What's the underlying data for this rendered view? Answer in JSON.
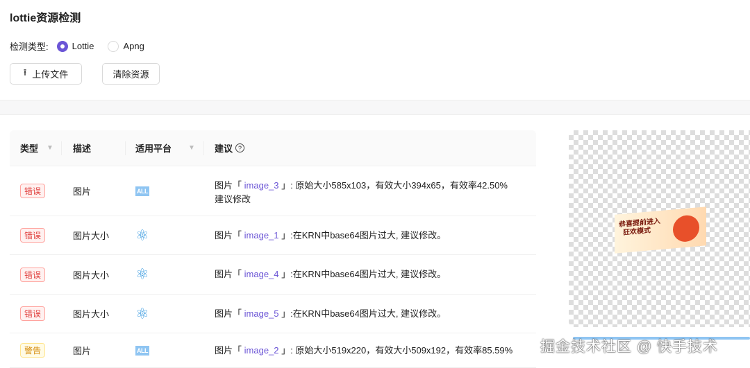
{
  "title": "lottie资源检测",
  "detect": {
    "label": "检测类型:",
    "options": [
      "Lottie",
      "Apng"
    ],
    "selected": "Lottie"
  },
  "buttons": {
    "upload": "上传文件",
    "clear": "清除资源"
  },
  "table": {
    "headers": {
      "type": "类型",
      "desc": "描述",
      "platform": "适用平台",
      "advice": "建议"
    },
    "rows": [
      {
        "tag": "错误",
        "tag_kind": "error",
        "desc": "图片",
        "platform": "ALL",
        "prefix": "图片「",
        "link": "image_3",
        "suffix": "」: 原始大小585x103，有效大小394x65，有效率42.50%",
        "line2": "建议修改"
      },
      {
        "tag": "错误",
        "tag_kind": "error",
        "desc": "图片大小",
        "platform": "react",
        "prefix": "图片「",
        "link": "image_1",
        "suffix": "」:在KRN中base64图片过大, 建议修改。",
        "line2": ""
      },
      {
        "tag": "错误",
        "tag_kind": "error",
        "desc": "图片大小",
        "platform": "react",
        "prefix": "图片「",
        "link": "image_4",
        "suffix": "」:在KRN中base64图片过大, 建议修改。",
        "line2": ""
      },
      {
        "tag": "错误",
        "tag_kind": "error",
        "desc": "图片大小",
        "platform": "react",
        "prefix": "图片「",
        "link": "image_5",
        "suffix": "」:在KRN中base64图片过大, 建议修改。",
        "line2": ""
      },
      {
        "tag": "警告",
        "tag_kind": "warn",
        "desc": "图片",
        "platform": "ALL",
        "prefix": "图片「",
        "link": "image_2",
        "suffix": "」: 原始大小519x220，有效大小509x192，有效率85.59%",
        "line2": ""
      }
    ]
  },
  "preview": {
    "banner_line1": "恭喜提前进入",
    "banner_line2": "狂欢模式"
  },
  "watermark": "掘金技术社区 @ 快手技术"
}
